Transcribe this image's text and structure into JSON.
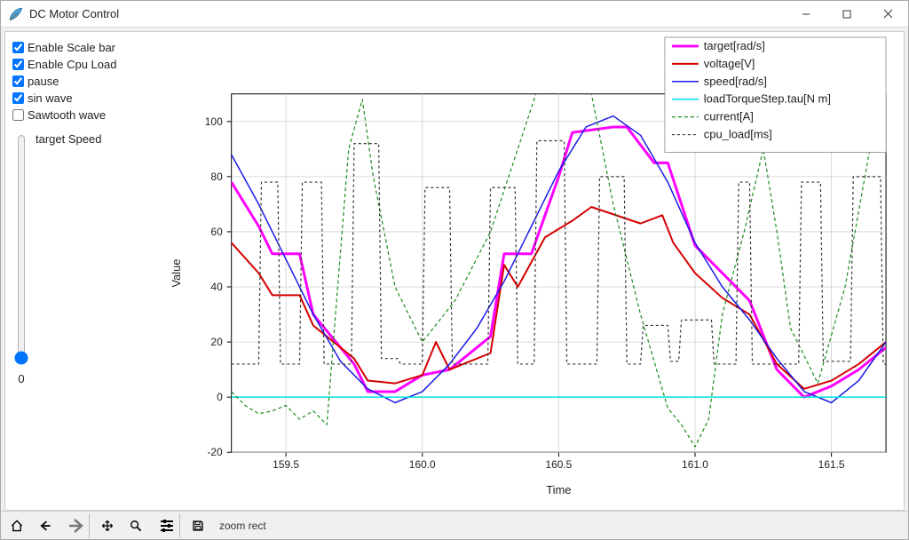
{
  "window": {
    "title": "DC Motor Control"
  },
  "sidebar": {
    "checks": [
      {
        "label": "Enable Scale bar",
        "checked": true
      },
      {
        "label": "Enable Cpu Load",
        "checked": true
      },
      {
        "label": "pause",
        "checked": true
      },
      {
        "label": "sin wave",
        "checked": true
      },
      {
        "label": "Sawtooth wave",
        "checked": false
      }
    ],
    "slider": {
      "label": "target Speed",
      "value": "0"
    }
  },
  "toolbar": {
    "status": "zoom rect"
  },
  "chart_data": {
    "type": "line",
    "xlabel": "Time",
    "ylabel": "Value",
    "xlim": [
      159.3,
      161.7
    ],
    "ylim": [
      -20,
      110
    ],
    "xticks": [
      159.5,
      160.0,
      160.5,
      161.0,
      161.5
    ],
    "yticks": [
      -20,
      0,
      20,
      40,
      60,
      80,
      100
    ],
    "series": [
      {
        "name": "target[rad/s]",
        "color": "#ff00ff",
        "lw": 3,
        "dash": "",
        "x": [
          159.3,
          159.4,
          159.45,
          159.55,
          159.6,
          159.75,
          159.8,
          159.9,
          160.0,
          160.1,
          160.25,
          160.3,
          160.4,
          160.5,
          160.55,
          160.7,
          160.75,
          160.85,
          160.9,
          161.0,
          161.2,
          161.3,
          161.4,
          161.5,
          161.6,
          161.7
        ],
        "y": [
          78,
          62,
          52,
          52,
          30,
          12,
          2,
          2,
          8,
          10,
          22,
          52,
          52,
          80,
          96,
          98,
          98,
          85,
          85,
          55,
          35,
          10,
          0,
          4,
          10,
          18
        ]
      },
      {
        "name": "voltage[V]",
        "color": "#d40000",
        "lw": 2,
        "dash": "",
        "x": [
          159.3,
          159.4,
          159.45,
          159.55,
          159.6,
          159.75,
          159.8,
          159.9,
          160.0,
          160.05,
          160.1,
          160.25,
          160.3,
          160.35,
          160.45,
          160.55,
          160.62,
          160.8,
          160.88,
          160.92,
          161.0,
          161.1,
          161.2,
          161.3,
          161.4,
          161.5,
          161.6,
          161.7
        ],
        "y": [
          56,
          45,
          37,
          37,
          26,
          14,
          6,
          5,
          8,
          20,
          10,
          16,
          48,
          40,
          58,
          64,
          69,
          63,
          66,
          56,
          45,
          36,
          30,
          12,
          3,
          6,
          12,
          20
        ]
      },
      {
        "name": "speed[rad/s]",
        "color": "#1a1ae6",
        "lw": 1.5,
        "dash": "",
        "x": [
          159.3,
          159.4,
          159.5,
          159.6,
          159.7,
          159.8,
          159.9,
          160.0,
          160.1,
          160.2,
          160.3,
          160.4,
          160.5,
          160.6,
          160.7,
          160.8,
          160.9,
          161.0,
          161.1,
          161.2,
          161.3,
          161.4,
          161.5,
          161.6,
          161.7
        ],
        "y": [
          88,
          70,
          50,
          30,
          13,
          3,
          -2,
          2,
          12,
          25,
          42,
          62,
          82,
          98,
          102,
          95,
          78,
          56,
          40,
          28,
          14,
          2,
          -2,
          6,
          20
        ]
      },
      {
        "name": "loadTorqueStep.tau[N m]",
        "color": "#00e0e0",
        "lw": 1.5,
        "dash": "",
        "x": [
          159.3,
          161.7
        ],
        "y": [
          0,
          0
        ]
      },
      {
        "name": "current[A]",
        "color": "#1a8c1a",
        "lw": 1.2,
        "dash": "4,3",
        "x": [
          159.3,
          159.35,
          159.4,
          159.45,
          159.5,
          159.55,
          159.6,
          159.65,
          159.68,
          159.73,
          159.78,
          159.82,
          159.9,
          160.0,
          160.12,
          160.25,
          160.35,
          160.45,
          160.52,
          160.6,
          160.7,
          160.8,
          160.9,
          160.95,
          161.0,
          161.05,
          161.1,
          161.18,
          161.25,
          161.3,
          161.35,
          161.45,
          161.55,
          161.65,
          161.7
        ],
        "y": [
          2,
          -3,
          -6,
          -5,
          -3,
          -8,
          -5,
          -10,
          28,
          90,
          108,
          80,
          40,
          20,
          35,
          60,
          90,
          120,
          135,
          120,
          70,
          30,
          -4,
          -10,
          -18,
          -8,
          30,
          60,
          90,
          60,
          25,
          5,
          40,
          95,
          110
        ]
      },
      {
        "name": "cpu_load[ms]",
        "color": "#333333",
        "lw": 1.2,
        "dash": "3,3",
        "x": [
          159.3,
          159.4,
          159.41,
          159.47,
          159.48,
          159.55,
          159.56,
          159.63,
          159.64,
          159.74,
          159.75,
          159.84,
          159.85,
          159.91,
          159.92,
          160.0,
          160.01,
          160.1,
          160.11,
          160.24,
          160.25,
          160.34,
          160.35,
          160.41,
          160.42,
          160.52,
          160.53,
          160.64,
          160.65,
          160.74,
          160.75,
          160.8,
          160.81,
          160.9,
          160.91,
          160.94,
          160.95,
          161.06,
          161.07,
          161.15,
          161.16,
          161.2,
          161.21,
          161.38,
          161.39,
          161.46,
          161.47,
          161.57,
          161.58,
          161.68,
          161.69,
          161.7
        ],
        "y": [
          12,
          12,
          78,
          78,
          12,
          12,
          78,
          78,
          12,
          12,
          92,
          92,
          14,
          14,
          12,
          12,
          76,
          76,
          12,
          12,
          76,
          76,
          12,
          12,
          93,
          93,
          12,
          12,
          80,
          80,
          12,
          12,
          26,
          26,
          13,
          13,
          28,
          28,
          12,
          12,
          78,
          78,
          12,
          12,
          78,
          78,
          13,
          13,
          80,
          80,
          12,
          12
        ]
      }
    ]
  }
}
